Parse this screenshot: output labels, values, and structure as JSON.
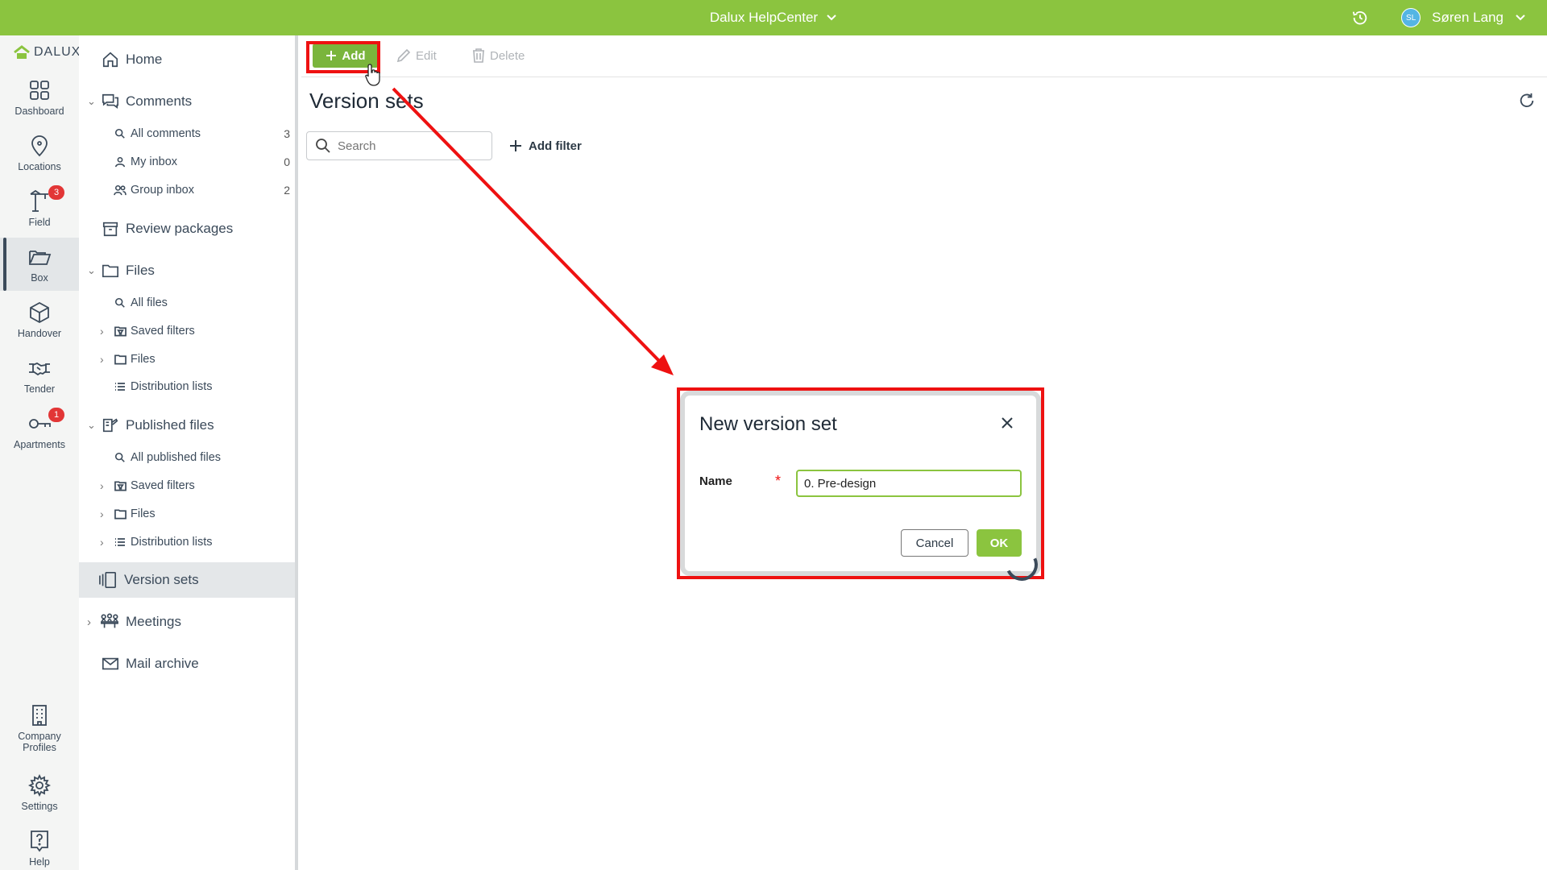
{
  "topbar": {
    "project": "Dalux HelpCenter",
    "user_initials": "SL",
    "user_name": "Søren Lang"
  },
  "rail": {
    "logo": "DALUX",
    "items": [
      {
        "label": "Dashboard",
        "icon": "grid-icon"
      },
      {
        "label": "Locations",
        "icon": "map-pin-icon"
      },
      {
        "label": "Field",
        "icon": "crane-icon",
        "badge": "3"
      },
      {
        "label": "Box",
        "icon": "folder-open-icon"
      },
      {
        "label": "Handover",
        "icon": "cube-icon"
      },
      {
        "label": "Tender",
        "icon": "handshake-icon"
      },
      {
        "label": "Apartments",
        "icon": "key-icon",
        "badge": "1"
      }
    ],
    "bottom": [
      {
        "label": "Company Profiles",
        "icon": "building-icon"
      },
      {
        "label": "Settings",
        "icon": "gear-icon"
      },
      {
        "label": "Help",
        "icon": "help-icon"
      }
    ]
  },
  "nav": {
    "home": "Home",
    "comments": "Comments",
    "all_comments": "All comments",
    "all_comments_count": "3",
    "my_inbox": "My inbox",
    "my_inbox_count": "0",
    "group_inbox": "Group inbox",
    "group_inbox_count": "2",
    "review_packages": "Review packages",
    "files": "Files",
    "all_files": "All files",
    "saved_filters": "Saved filters",
    "files_folder": "Files",
    "distribution_lists": "Distribution lists",
    "published_files": "Published files",
    "all_published_files": "All published files",
    "pub_saved_filters": "Saved filters",
    "pub_files": "Files",
    "pub_distribution_lists": "Distribution lists",
    "version_sets": "Version sets",
    "meetings": "Meetings",
    "mail_archive": "Mail archive"
  },
  "toolbar": {
    "add": "Add",
    "edit": "Edit",
    "delete": "Delete"
  },
  "main": {
    "title": "Version sets",
    "search_placeholder": "Search",
    "add_filter": "Add filter"
  },
  "dialog": {
    "title": "New version set",
    "name_label": "Name",
    "required_mark": "*",
    "name_value": "0. Pre-design",
    "cancel": "Cancel",
    "ok": "OK"
  },
  "colors": {
    "brand_green": "#8bc43f",
    "annotation_red": "#ee1111",
    "rail_bg": "#f4f5f4"
  }
}
